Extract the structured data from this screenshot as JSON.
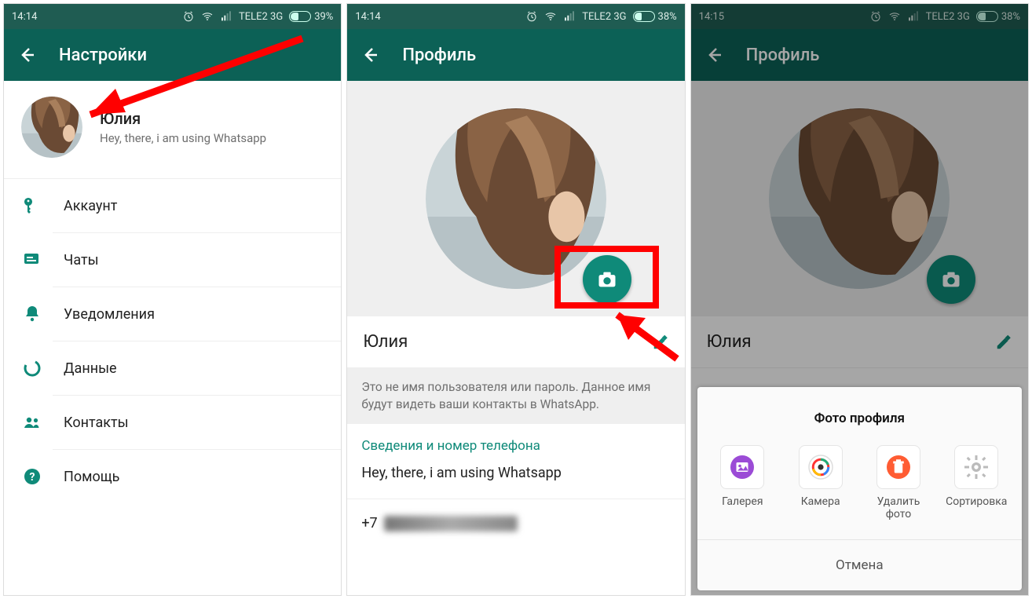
{
  "s1": {
    "time": "14:14",
    "carrier": "TELE2 3G",
    "battery": "39%",
    "title": "Настройки",
    "profile": {
      "name": "Юлия",
      "status": "Hey, there, i am using Whatsapp"
    },
    "menu": {
      "account": "Аккаунт",
      "chats": "Чаты",
      "notifications": "Уведомления",
      "data": "Данные",
      "contacts": "Контакты",
      "help": "Помощь"
    }
  },
  "s2": {
    "time": "14:14",
    "carrier": "TELE2 3G",
    "battery": "38%",
    "title": "Профиль",
    "name": "Юлия",
    "hint": "Это не имя пользователя или пароль. Данное имя будут видеть ваши контакты в WhatsApp.",
    "section_title": "Сведения и номер телефона",
    "status": "Hey, there, i am using Whatsapp",
    "phone_prefix": "+7"
  },
  "s3": {
    "time": "14:15",
    "carrier": "TELE2 3G",
    "battery": "38%",
    "title": "Профиль",
    "name": "Юлия",
    "sheet": {
      "title": "Фото профиля",
      "gallery": "Галерея",
      "camera": "Камера",
      "delete": "Удалить фото",
      "sort": "Сортировка",
      "cancel": "Отмена"
    }
  }
}
